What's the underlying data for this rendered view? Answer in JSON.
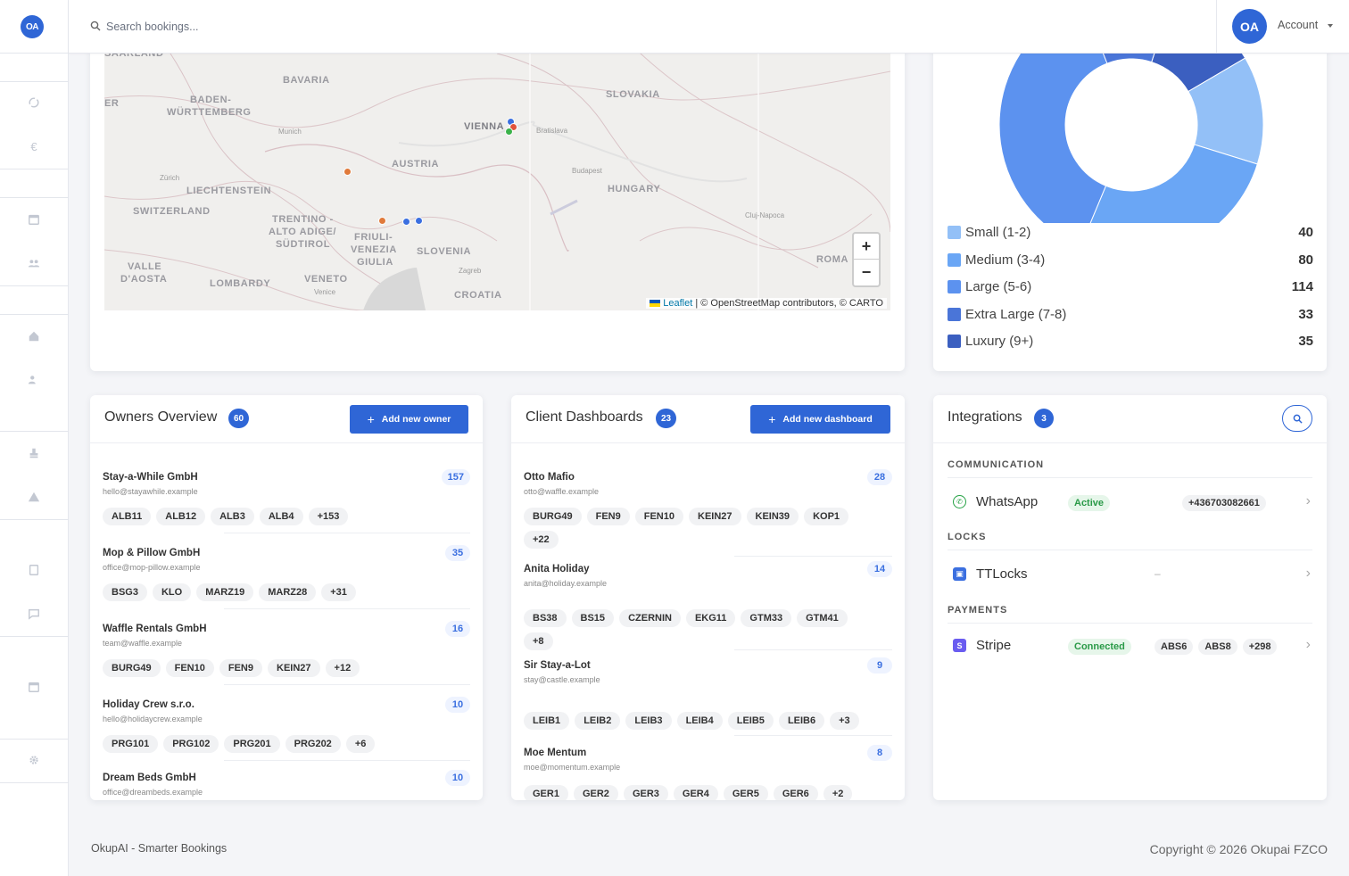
{
  "brand": {
    "logo_text": "OA",
    "avatar_text": "OA"
  },
  "search": {
    "placeholder": "Search bookings..."
  },
  "account": {
    "label": "Account"
  },
  "map": {
    "labels": {
      "bavaria": "BAVARIA",
      "baden": "BADEN-",
      "wurttemberg": "WÜRTTEMBERG",
      "munich": "Munich",
      "zurich": "Zürich",
      "liechtenstein": "LIECHTENSTEIN",
      "switzerland": "SWITZERLAND",
      "austria": "AUSTRIA",
      "vienna": "VIENNA",
      "bratislava": "Bratislava",
      "slovakia": "SLOVAKIA",
      "budapest": "Budapest",
      "hungary": "HUNGARY",
      "cluj": "Cluj-Napoca",
      "trentino1": "TRENTINO -",
      "trentino2": "ALTO ADIGE/",
      "trentino3": "SÜDTIROL",
      "friuli1": "FRIULI-",
      "friuli2": "VENEZIA",
      "friuli3": "GIULIA",
      "slovenia": "SLOVENIA",
      "zagreb": "Zagreb",
      "valle1": "VALLE",
      "valle2": "D'AOSTA",
      "lombardy": "LOMBARDY",
      "veneto": "VENETO",
      "venice": "Venice",
      "croatia": "CROATIA",
      "roma": "ROMA",
      "saarland": "SAARLAND",
      "er": "ER"
    },
    "zoom_in": "+",
    "zoom_out": "−",
    "attribution_link": "Leaflet",
    "attribution_text": " | © OpenStreetMap contributors, © CARTO"
  },
  "chart_data": {
    "type": "pie",
    "variant": "donut",
    "categories": [
      "Small (1-2)",
      "Medium (3-4)",
      "Large (5-6)",
      "Extra Large (7-8)",
      "Luxury (9+)"
    ],
    "values": [
      40,
      80,
      114,
      33,
      35
    ],
    "colors": [
      "#93c0f7",
      "#6aa6f5",
      "#5c92ef",
      "#4a75d8",
      "#3b5fc0"
    ],
    "legend_position": "bottom"
  },
  "owners": {
    "title": "Owners Overview",
    "count": "60",
    "add_label": "Add new owner",
    "items": [
      {
        "name": "Stay-a-While GmbH",
        "email": "hello@stayawhile.example",
        "count": "157",
        "tags": [
          "ALB11",
          "ALB12",
          "ALB3",
          "ALB4",
          "+153"
        ]
      },
      {
        "name": "Mop & Pillow GmbH",
        "email": "office@mop-pillow.example",
        "count": "35",
        "tags": [
          "BSG3",
          "KLO",
          "MARZ19",
          "MARZ28",
          "+31"
        ]
      },
      {
        "name": "Waffle Rentals GmbH",
        "email": "team@waffle.example",
        "count": "16",
        "tags": [
          "BURG49",
          "FEN10",
          "FEN9",
          "KEIN27",
          "+12"
        ]
      },
      {
        "name": "Holiday Crew s.r.o.",
        "email": "hello@holidaycrew.example",
        "count": "10",
        "tags": [
          "PRG101",
          "PRG102",
          "PRG201",
          "PRG202",
          "+6"
        ]
      },
      {
        "name": "Dream Beds GmbH",
        "email": "office@dreambeds.example",
        "count": "10",
        "tags": []
      }
    ]
  },
  "clients": {
    "title": "Client Dashboards",
    "count": "23",
    "add_label": "Add new dashboard",
    "items": [
      {
        "name": "Otto Mafio",
        "email": "otto@waffle.example",
        "count": "28",
        "tags": [
          "BURG49",
          "FEN9",
          "FEN10",
          "KEIN27",
          "KEIN39",
          "KOP1",
          "+22"
        ]
      },
      {
        "name": "Anita Holiday",
        "email": "anita@holiday.example",
        "count": "14",
        "tags": [
          "BS38",
          "BS15",
          "CZERNIN",
          "EKG11",
          "GTM33",
          "GTM41",
          "+8"
        ]
      },
      {
        "name": "Sir Stay-a-Lot",
        "email": "stay@castle.example",
        "count": "9",
        "tags": [
          "LEIB1",
          "LEIB2",
          "LEIB3",
          "LEIB4",
          "LEIB5",
          "LEIB6",
          "+3"
        ]
      },
      {
        "name": "Moe Mentum",
        "email": "moe@momentum.example",
        "count": "8",
        "tags": [
          "GER1",
          "GER2",
          "GER3",
          "GER4",
          "GER5",
          "GER6",
          "+2"
        ]
      }
    ]
  },
  "integrations": {
    "title": "Integrations",
    "count": "3",
    "groups": {
      "communication": "COMMUNICATION",
      "locks": "LOCKS",
      "payments": "PAYMENTS"
    },
    "whatsapp": {
      "name": "WhatsApp",
      "status": "Active",
      "detail": "+436703082661"
    },
    "ttlocks": {
      "name": "TTLocks",
      "detail": "–"
    },
    "stripe": {
      "name": "Stripe",
      "status": "Connected",
      "tags": [
        "ABS6",
        "ABS8",
        "+298"
      ]
    }
  },
  "footer": {
    "left": "OkupAI - Smarter Bookings",
    "right": "Copyright © 2026 Okupai FZCO"
  }
}
